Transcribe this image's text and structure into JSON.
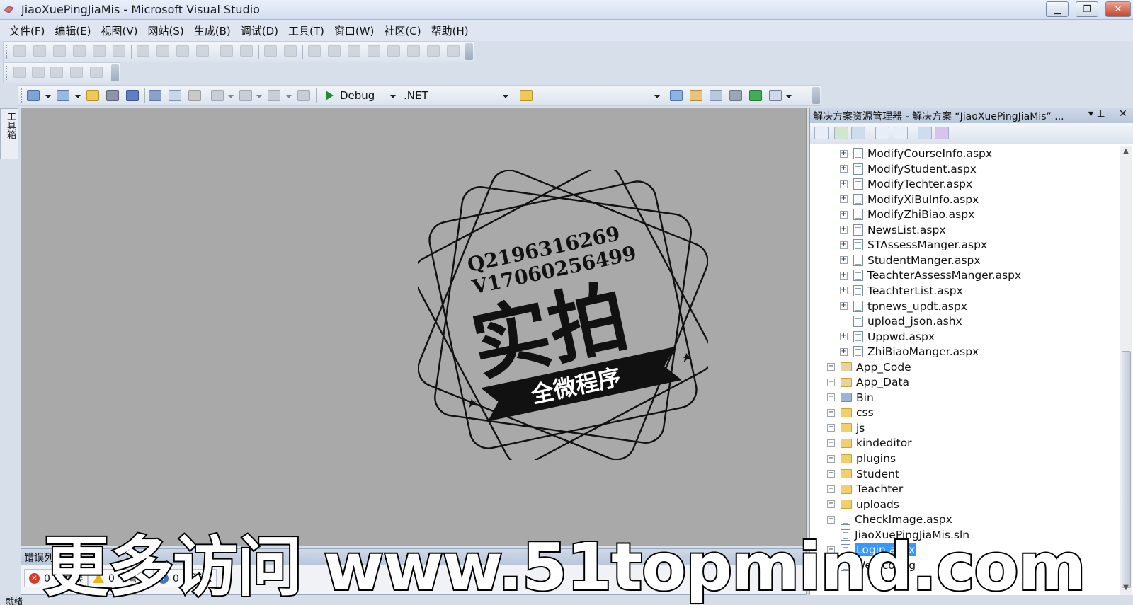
{
  "window": {
    "title": "JiaoXuePingJiaMis - Microsoft Visual Studio",
    "min_glyph": "▁",
    "max_glyph": "❐",
    "close_glyph": "✕"
  },
  "menu": [
    "文件(F)",
    "编辑(E)",
    "视图(V)",
    "网站(S)",
    "生成(B)",
    "调试(D)",
    "工具(T)",
    "窗口(W)",
    "社区(C)",
    "帮助(H)"
  ],
  "standard_toolbar": {
    "config": "Debug",
    "platform": ".NET"
  },
  "toolbox": {
    "label": "工具箱"
  },
  "stamp": {
    "line1": "Q2196316269",
    "line2": "V17060256499",
    "main": "实拍",
    "ribbon": "全微程序"
  },
  "error_list": {
    "title": "错误列表",
    "errors": "0 个错误",
    "warnings": "0 个警告",
    "messages": "0 个消息"
  },
  "status": "就绪",
  "solution_explorer": {
    "title": "解决方案资源管理器 - 解决方案 “JiaoXuePingJiaMis” ...",
    "pin_glyph": "▾ ⊥",
    "close_glyph": "✕",
    "items": [
      {
        "label": "ModifyCourseInfo.aspx",
        "kind": "page",
        "level": 2,
        "expandable": true
      },
      {
        "label": "ModifyStudent.aspx",
        "kind": "page",
        "level": 2,
        "expandable": true
      },
      {
        "label": "ModifyTechter.aspx",
        "kind": "page",
        "level": 2,
        "expandable": true
      },
      {
        "label": "ModifyXiBuInfo.aspx",
        "kind": "page",
        "level": 2,
        "expandable": true
      },
      {
        "label": "ModifyZhiBiao.aspx",
        "kind": "page",
        "level": 2,
        "expandable": true
      },
      {
        "label": "NewsList.aspx",
        "kind": "page",
        "level": 2,
        "expandable": true
      },
      {
        "label": "STAssessManger.aspx",
        "kind": "page",
        "level": 2,
        "expandable": true
      },
      {
        "label": "StudentManger.aspx",
        "kind": "page",
        "level": 2,
        "expandable": true
      },
      {
        "label": "TeachterAssessManger.aspx",
        "kind": "page",
        "level": 2,
        "expandable": true
      },
      {
        "label": "TeachterList.aspx",
        "kind": "page",
        "level": 2,
        "expandable": true
      },
      {
        "label": "tpnews_updt.aspx",
        "kind": "page",
        "level": 2,
        "expandable": true
      },
      {
        "label": "upload_json.ashx",
        "kind": "handler",
        "level": 2,
        "expandable": false
      },
      {
        "label": "Uppwd.aspx",
        "kind": "page",
        "level": 2,
        "expandable": true
      },
      {
        "label": "ZhiBiaoManger.aspx",
        "kind": "page",
        "level": 2,
        "expandable": true
      },
      {
        "label": "App_Code",
        "kind": "special-folder",
        "level": 1,
        "expandable": true
      },
      {
        "label": "App_Data",
        "kind": "special-folder",
        "level": 1,
        "expandable": true
      },
      {
        "label": "Bin",
        "kind": "bin-folder",
        "level": 1,
        "expandable": true
      },
      {
        "label": "css",
        "kind": "folder",
        "level": 1,
        "expandable": true
      },
      {
        "label": "js",
        "kind": "folder",
        "level": 1,
        "expandable": true
      },
      {
        "label": "kindeditor",
        "kind": "folder",
        "level": 1,
        "expandable": true
      },
      {
        "label": "plugins",
        "kind": "folder",
        "level": 1,
        "expandable": true
      },
      {
        "label": "Student",
        "kind": "folder",
        "level": 1,
        "expandable": true
      },
      {
        "label": "Teachter",
        "kind": "folder",
        "level": 1,
        "expandable": true
      },
      {
        "label": "uploads",
        "kind": "folder",
        "level": 1,
        "expandable": true
      },
      {
        "label": "CheckImage.aspx",
        "kind": "page",
        "level": 1,
        "expandable": true
      },
      {
        "label": "JiaoXuePingJiaMis.sln",
        "kind": "file",
        "level": 1,
        "expandable": false
      },
      {
        "label": "Login.aspx",
        "kind": "page",
        "level": 1,
        "expandable": true,
        "selected": true
      },
      {
        "label": "Web.config",
        "kind": "file",
        "level": 1,
        "expandable": false
      }
    ]
  },
  "watermark": "更多访问 www.51topmind.com"
}
